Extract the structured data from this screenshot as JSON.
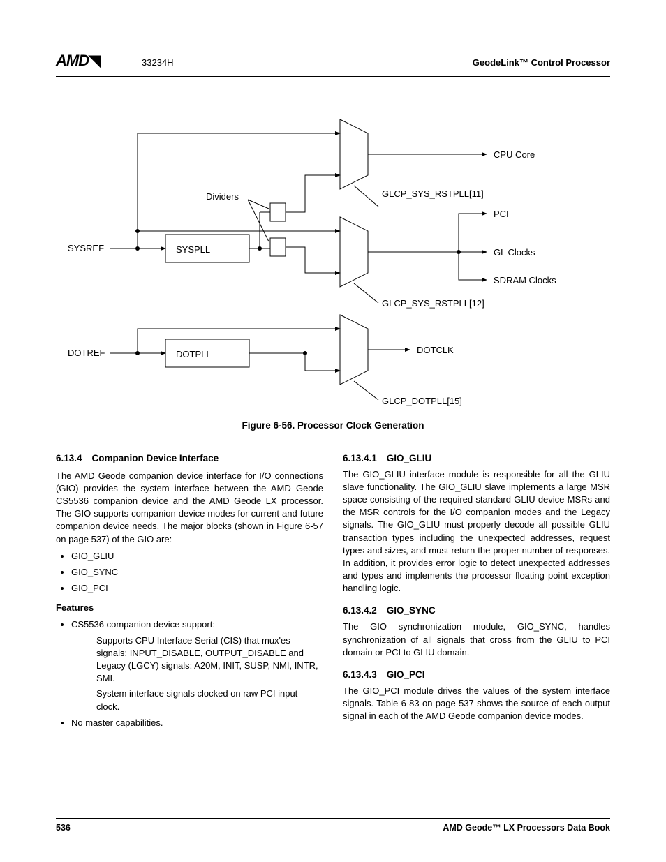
{
  "header": {
    "logo": "AMD",
    "doc_id": "33234H",
    "right": "GeodeLink™ Control Processor"
  },
  "diagram": {
    "labels": {
      "sysref": "SYSREF",
      "dotref": "DOTREF",
      "dividers": "Dividers",
      "syspll": "SYSPLL",
      "dotpll": "DOTPLL",
      "cpu_core": "CPU Core",
      "rstpll11": "GLCP_SYS_RSTPLL[11]",
      "pci": "PCI",
      "gl_clocks": "GL Clocks",
      "sdram_clocks": "SDRAM Clocks",
      "rstpll12": "GLCP_SYS_RSTPLL[12]",
      "dotclk": "DOTCLK",
      "dotpll15": "GLCP_DOTPLL[15]"
    }
  },
  "figure_caption": "Figure 6-56.  Processor Clock Generation",
  "left_col": {
    "sec_num": "6.13.4",
    "sec_title": "Companion Device Interface",
    "para1": "The AMD Geode companion device interface for I/O connections (GIO) provides the system interface between the AMD Geode CS5536 companion device and the AMD Geode LX processor. The GIO supports companion device modes for current and future companion device needs. The major blocks (shown in Figure 6-57 on page 537) of the GIO are:",
    "bullets_main": [
      "GIO_GLIU",
      "GIO_SYNC",
      "GIO_PCI"
    ],
    "features_hdr": "Features",
    "feat1": "CS5536 companion device support:",
    "feat1_sub1": "Supports CPU Interface Serial (CIS) that mux'es signals: INPUT_DISABLE, OUTPUT_DISABLE and Legacy (LGCY) signals: A20M, INIT, SUSP, NMI, INTR, SMI.",
    "feat1_sub2": "System interface signals clocked on raw PCI input clock.",
    "feat2": "No master capabilities."
  },
  "right_col": {
    "s1_num": "6.13.4.1",
    "s1_title": "GIO_GLIU",
    "s1_para": "The GIO_GLIU interface module is responsible for all the GLIU slave functionality. The GIO_GLIU slave implements a large MSR space consisting of the required standard GLIU device MSRs and the MSR controls for the I/O companion modes and the Legacy signals. The GIO_GLIU must properly decode all possible GLIU transaction types including the unexpected addresses, request types and sizes, and must return the proper number of responses. In addition, it provides error logic to detect unexpected addresses and types and implements the processor floating point exception handling logic.",
    "s2_num": "6.13.4.2",
    "s2_title": "GIO_SYNC",
    "s2_para": "The GIO synchronization module, GIO_SYNC, handles synchronization of all signals that cross from the GLIU to PCI domain or PCI to GLIU domain.",
    "s3_num": "6.13.4.3",
    "s3_title": "GIO_PCI",
    "s3_para": "The GIO_PCI module drives the values of the system interface signals. Table 6-83 on page 537 shows the source of each output signal in each of the AMD Geode companion device modes."
  },
  "footer": {
    "page": "536",
    "book": "AMD Geode™ LX Processors Data Book"
  }
}
